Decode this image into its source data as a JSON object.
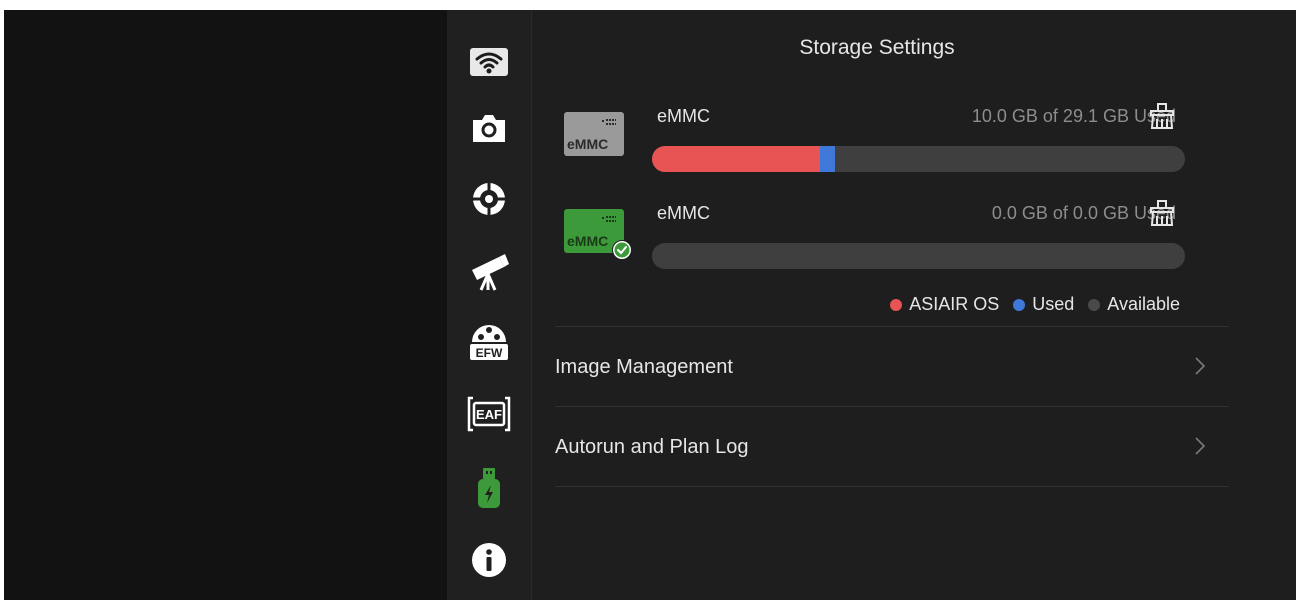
{
  "panel": {
    "title": "Storage Settings"
  },
  "storage": [
    {
      "drive_label": "eMMC",
      "name": "eMMC",
      "usage_text": "10.0 GB of 29.1 GB Used",
      "icon_color": "#9a9a9a",
      "label_color": "#2a2a2a",
      "selected": false,
      "bar": {
        "asiair_os_fraction": 0.315,
        "used_fraction": 0.029
      }
    },
    {
      "drive_label": "eMMC",
      "name": "eMMC",
      "usage_text": "0.0 GB of 0.0 GB Used",
      "icon_color": "#3d9a3a",
      "label_color": "#1a3a18",
      "selected": true,
      "bar": {
        "asiair_os_fraction": 0,
        "used_fraction": 0
      }
    }
  ],
  "legend": [
    {
      "label": "ASIAIR OS",
      "color": "#e85454"
    },
    {
      "label": "Used",
      "color": "#3f78d8"
    },
    {
      "label": "Available",
      "color": "#4a4a4a"
    }
  ],
  "menu": [
    {
      "label": "Image Management"
    },
    {
      "label": "Autorun and Plan Log"
    }
  ],
  "rail_icons": [
    "wifi-icon",
    "camera-icon",
    "mount-icon",
    "telescope-icon",
    "filter-wheel-icon",
    "focuser-icon",
    "storage-icon",
    "info-icon"
  ],
  "rail_icon_labels": {
    "filter_wheel": "EFW",
    "focuser": "EAF"
  },
  "colors": {
    "accent_green": "#3d9a3a",
    "bar_track": "#3f3f3f",
    "asiair_os": "#e85454",
    "used": "#3f78d8"
  }
}
